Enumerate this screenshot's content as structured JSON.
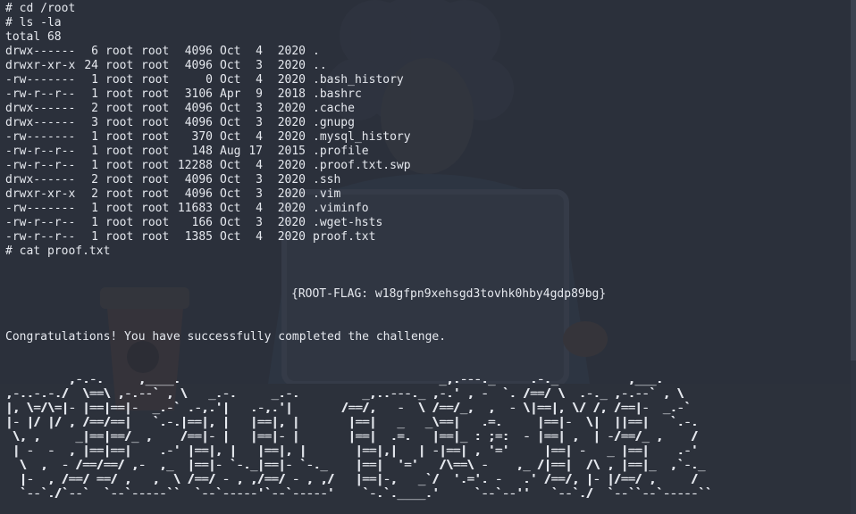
{
  "terminal": {
    "commands": {
      "cd": "# cd /root",
      "ls": "# ls -la",
      "total": "total 68",
      "cat": "# cat proof.txt"
    },
    "listing": [
      {
        "perm": "drwx------",
        "links": "6",
        "owner": "root",
        "group": "root",
        "size": "4096",
        "month": "Oct",
        "day": "4",
        "year": "2020",
        "name": "."
      },
      {
        "perm": "drwxr-xr-x",
        "links": "24",
        "owner": "root",
        "group": "root",
        "size": "4096",
        "month": "Oct",
        "day": "3",
        "year": "2020",
        "name": ".."
      },
      {
        "perm": "-rw-------",
        "links": "1",
        "owner": "root",
        "group": "root",
        "size": "0",
        "month": "Oct",
        "day": "4",
        "year": "2020",
        "name": ".bash_history"
      },
      {
        "perm": "-rw-r--r--",
        "links": "1",
        "owner": "root",
        "group": "root",
        "size": "3106",
        "month": "Apr",
        "day": "9",
        "year": "2018",
        "name": ".bashrc"
      },
      {
        "perm": "drwx------",
        "links": "2",
        "owner": "root",
        "group": "root",
        "size": "4096",
        "month": "Oct",
        "day": "3",
        "year": "2020",
        "name": ".cache"
      },
      {
        "perm": "drwx------",
        "links": "3",
        "owner": "root",
        "group": "root",
        "size": "4096",
        "month": "Oct",
        "day": "3",
        "year": "2020",
        "name": ".gnupg"
      },
      {
        "perm": "-rw-------",
        "links": "1",
        "owner": "root",
        "group": "root",
        "size": "370",
        "month": "Oct",
        "day": "4",
        "year": "2020",
        "name": ".mysql_history"
      },
      {
        "perm": "-rw-r--r--",
        "links": "1",
        "owner": "root",
        "group": "root",
        "size": "148",
        "month": "Aug",
        "day": "17",
        "year": "2015",
        "name": ".profile"
      },
      {
        "perm": "-rw-r--r--",
        "links": "1",
        "owner": "root",
        "group": "root",
        "size": "12288",
        "month": "Oct",
        "day": "4",
        "year": "2020",
        "name": ".proof.txt.swp"
      },
      {
        "perm": "drwx------",
        "links": "2",
        "owner": "root",
        "group": "root",
        "size": "4096",
        "month": "Oct",
        "day": "3",
        "year": "2020",
        "name": ".ssh"
      },
      {
        "perm": "drwxr-xr-x",
        "links": "2",
        "owner": "root",
        "group": "root",
        "size": "4096",
        "month": "Oct",
        "day": "3",
        "year": "2020",
        "name": ".vim"
      },
      {
        "perm": "-rw-------",
        "links": "1",
        "owner": "root",
        "group": "root",
        "size": "11683",
        "month": "Oct",
        "day": "4",
        "year": "2020",
        "name": ".viminfo"
      },
      {
        "perm": "-rw-r--r--",
        "links": "1",
        "owner": "root",
        "group": "root",
        "size": "166",
        "month": "Oct",
        "day": "3",
        "year": "2020",
        "name": ".wget-hsts"
      },
      {
        "perm": "-rw-r--r--",
        "links": "1",
        "owner": "root",
        "group": "root",
        "size": "1385",
        "month": "Oct",
        "day": "4",
        "year": "2020",
        "name": "proof.txt"
      }
    ],
    "flag": "{ROOT-FLAG: w18gfpn9xehsgd3tovhk0hby4gdp89bg}",
    "congrats": "Congratulations! You have successfully completed the challenge.",
    "banner": [
      "         ,-.-.     ,____.                                     _,.---._     .-._          ,___.  ",
      ",-..-.-./  \\==\\ ,-.--` , \\   _.-.     _.-.         _,..---._ ,-.' , -  `. /==/ \\  .-._ ,-.--` , \\ ",
      "|, \\=/\\=|- |==|==|-  _.-` .-,.'|   .-,.'|       /==/,   -  \\ /==/_,  ,  - \\|==|, \\/ /, /==|-  _.-` ",
      "|- |/ |/ , /==/==|   `.-.|==|, |   |==|, |       |==|   _   _\\==|   .=.     |==|-  \\|  ||==|   `.-. ",
      " \\, ,     _|==|==/_ ,    /==|- |   |==|- |       |==|  .=.   |==|_ : ;=:  - |==| ,  | -/==/_ ,    / ",
      " | -  -  , |==|==|    .-' |==|, |   |==|, |       |==|,|   | -|==| , '='     |==| -   _ |==|    .-'  ",
      "  \\  ,  - /==/==/ ,-  ,_  |==|- `-._|==|- `-._    |==|  '='   /\\==\\ -    ,_ /|==|  /\\ , |==|_  ,`-._ ",
      "  |-  , /==/ ==/ ,   ,  \\ /==/ - , ,/==/ - , ,/   |==|-,   _`/  '.='. -   .' /==/, |- |/==/ ,     / ",
      "  `--`./`--`  `--`-----``  `--`-----'`--`-----'    `-.`.____.'     `--`--''   `--`./  `--``--`-----``  "
    ]
  },
  "colors": {
    "background": "#2b303b",
    "foreground": "#e6e9ef"
  },
  "icons": {
    "background": "person-with-laptop-illustration"
  }
}
